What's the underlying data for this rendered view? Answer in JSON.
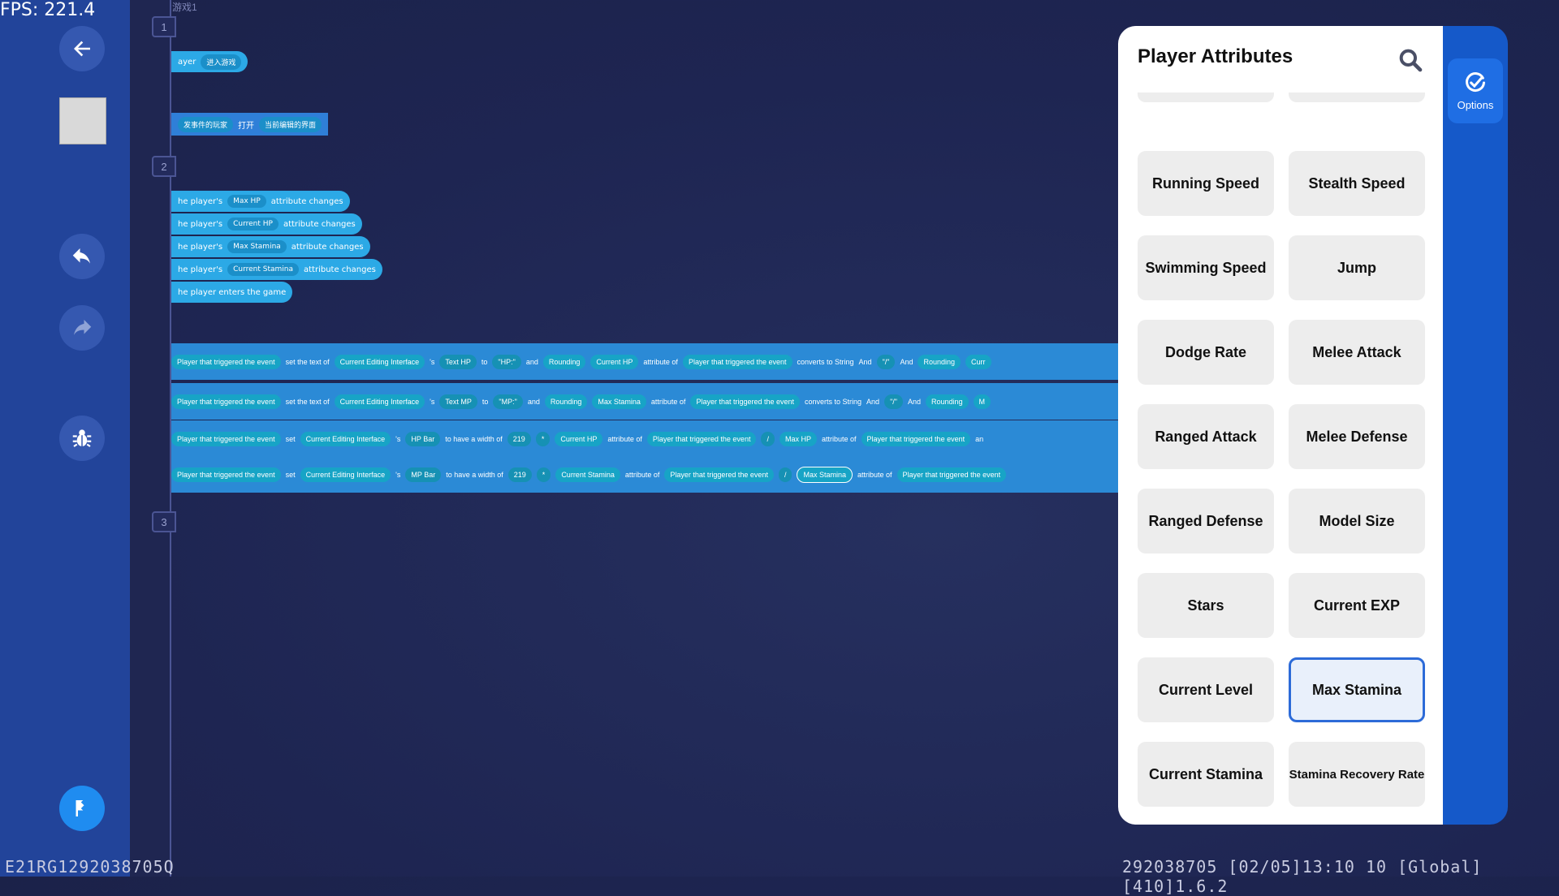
{
  "fps": "FPS: 221.4",
  "scene_label": "游戏1",
  "markers": [
    "1",
    "2",
    "3"
  ],
  "triggers": {
    "row1": {
      "subject": "ayer",
      "action": "进入游戏"
    },
    "row2": {
      "subject": "发事件的玩家",
      "verb": "打开",
      "target": "当前编辑的界面"
    },
    "events": [
      {
        "prefix": "he player's",
        "attr": "Max HP",
        "suffix": "attribute changes"
      },
      {
        "prefix": "he player's",
        "attr": "Current HP",
        "suffix": "attribute changes"
      },
      {
        "prefix": "he player's",
        "attr": "Max Stamina",
        "suffix": "attribute changes"
      },
      {
        "prefix": "he player's",
        "attr": "Current Stamina",
        "suffix": "attribute changes"
      }
    ],
    "enter": "he player enters the game"
  },
  "actions": [
    {
      "a": "Player that triggered the event",
      "b": "set the text of",
      "c": "Current Editing Interface",
      "d": "'s",
      "e": "Text HP",
      "f": "to",
      "g": "\"HP:\"",
      "h": "and",
      "i": "Rounding",
      "j": "Current HP",
      "k": "attribute of",
      "l": "Player that triggered the event",
      "m": "converts to String",
      "n": "And",
      "o": "\"/\"",
      "p": "And",
      "q": "Rounding",
      "r": "Curr"
    },
    {
      "a": "Player that triggered the event",
      "b": "set the text of",
      "c": "Current Editing Interface",
      "d": "'s",
      "e": "Text MP",
      "f": "to",
      "g": "\"MP:\"",
      "h": "and",
      "i": "Rounding",
      "j": "Max Stamina",
      "k": "attribute of",
      "l": "Player that triggered the event",
      "m": "converts to String",
      "n": "And",
      "o": "\"/\"",
      "p": "And",
      "q": "Rounding",
      "r": "M"
    },
    {
      "a": "Player that triggered the event",
      "b": "set",
      "c": "Current Editing Interface",
      "d": "'s",
      "e": "HP Bar",
      "f": "to have a width of",
      "g": "219",
      "h": "*",
      "i": "Current HP",
      "j": "attribute of",
      "k": "Player that triggered the event",
      "l": "/",
      "m": "Max HP",
      "n": "attribute of",
      "o": "Player that triggered the event",
      "p": "an"
    },
    {
      "a": "Player that triggered the event",
      "b": "set",
      "c": "Current Editing Interface",
      "d": "'s",
      "e": "MP Bar",
      "f": "to have a width of",
      "g": "219",
      "h": "*",
      "i": "Current Stamina",
      "j": "attribute of",
      "k": "Player that triggered the event",
      "l": "/",
      "m": "Max Stamina",
      "n": "attribute of",
      "o": "Player that triggered the event"
    }
  ],
  "panel": {
    "title": "Player Attributes",
    "items": [
      "Running Speed",
      "Stealth Speed",
      "Swimming Speed",
      "Jump",
      "Dodge Rate",
      "Melee Attack",
      "Ranged Attack",
      "Melee Defense",
      "Ranged Defense",
      "Model Size",
      "Stars",
      "Current EXP",
      "Current Level",
      "Max Stamina",
      "Current Stamina",
      "Stamina Recovery Rate"
    ],
    "selected": "Max Stamina"
  },
  "options_label": "Options",
  "footer": {
    "left": "E21RG1292038705Q",
    "right": "292038705   [02/05]13:10 10  [Global][410]1.6.2"
  },
  "colors": {
    "accent": "#2d6bd8",
    "sidebar": "#22449a",
    "block": "#2ca9e6"
  }
}
